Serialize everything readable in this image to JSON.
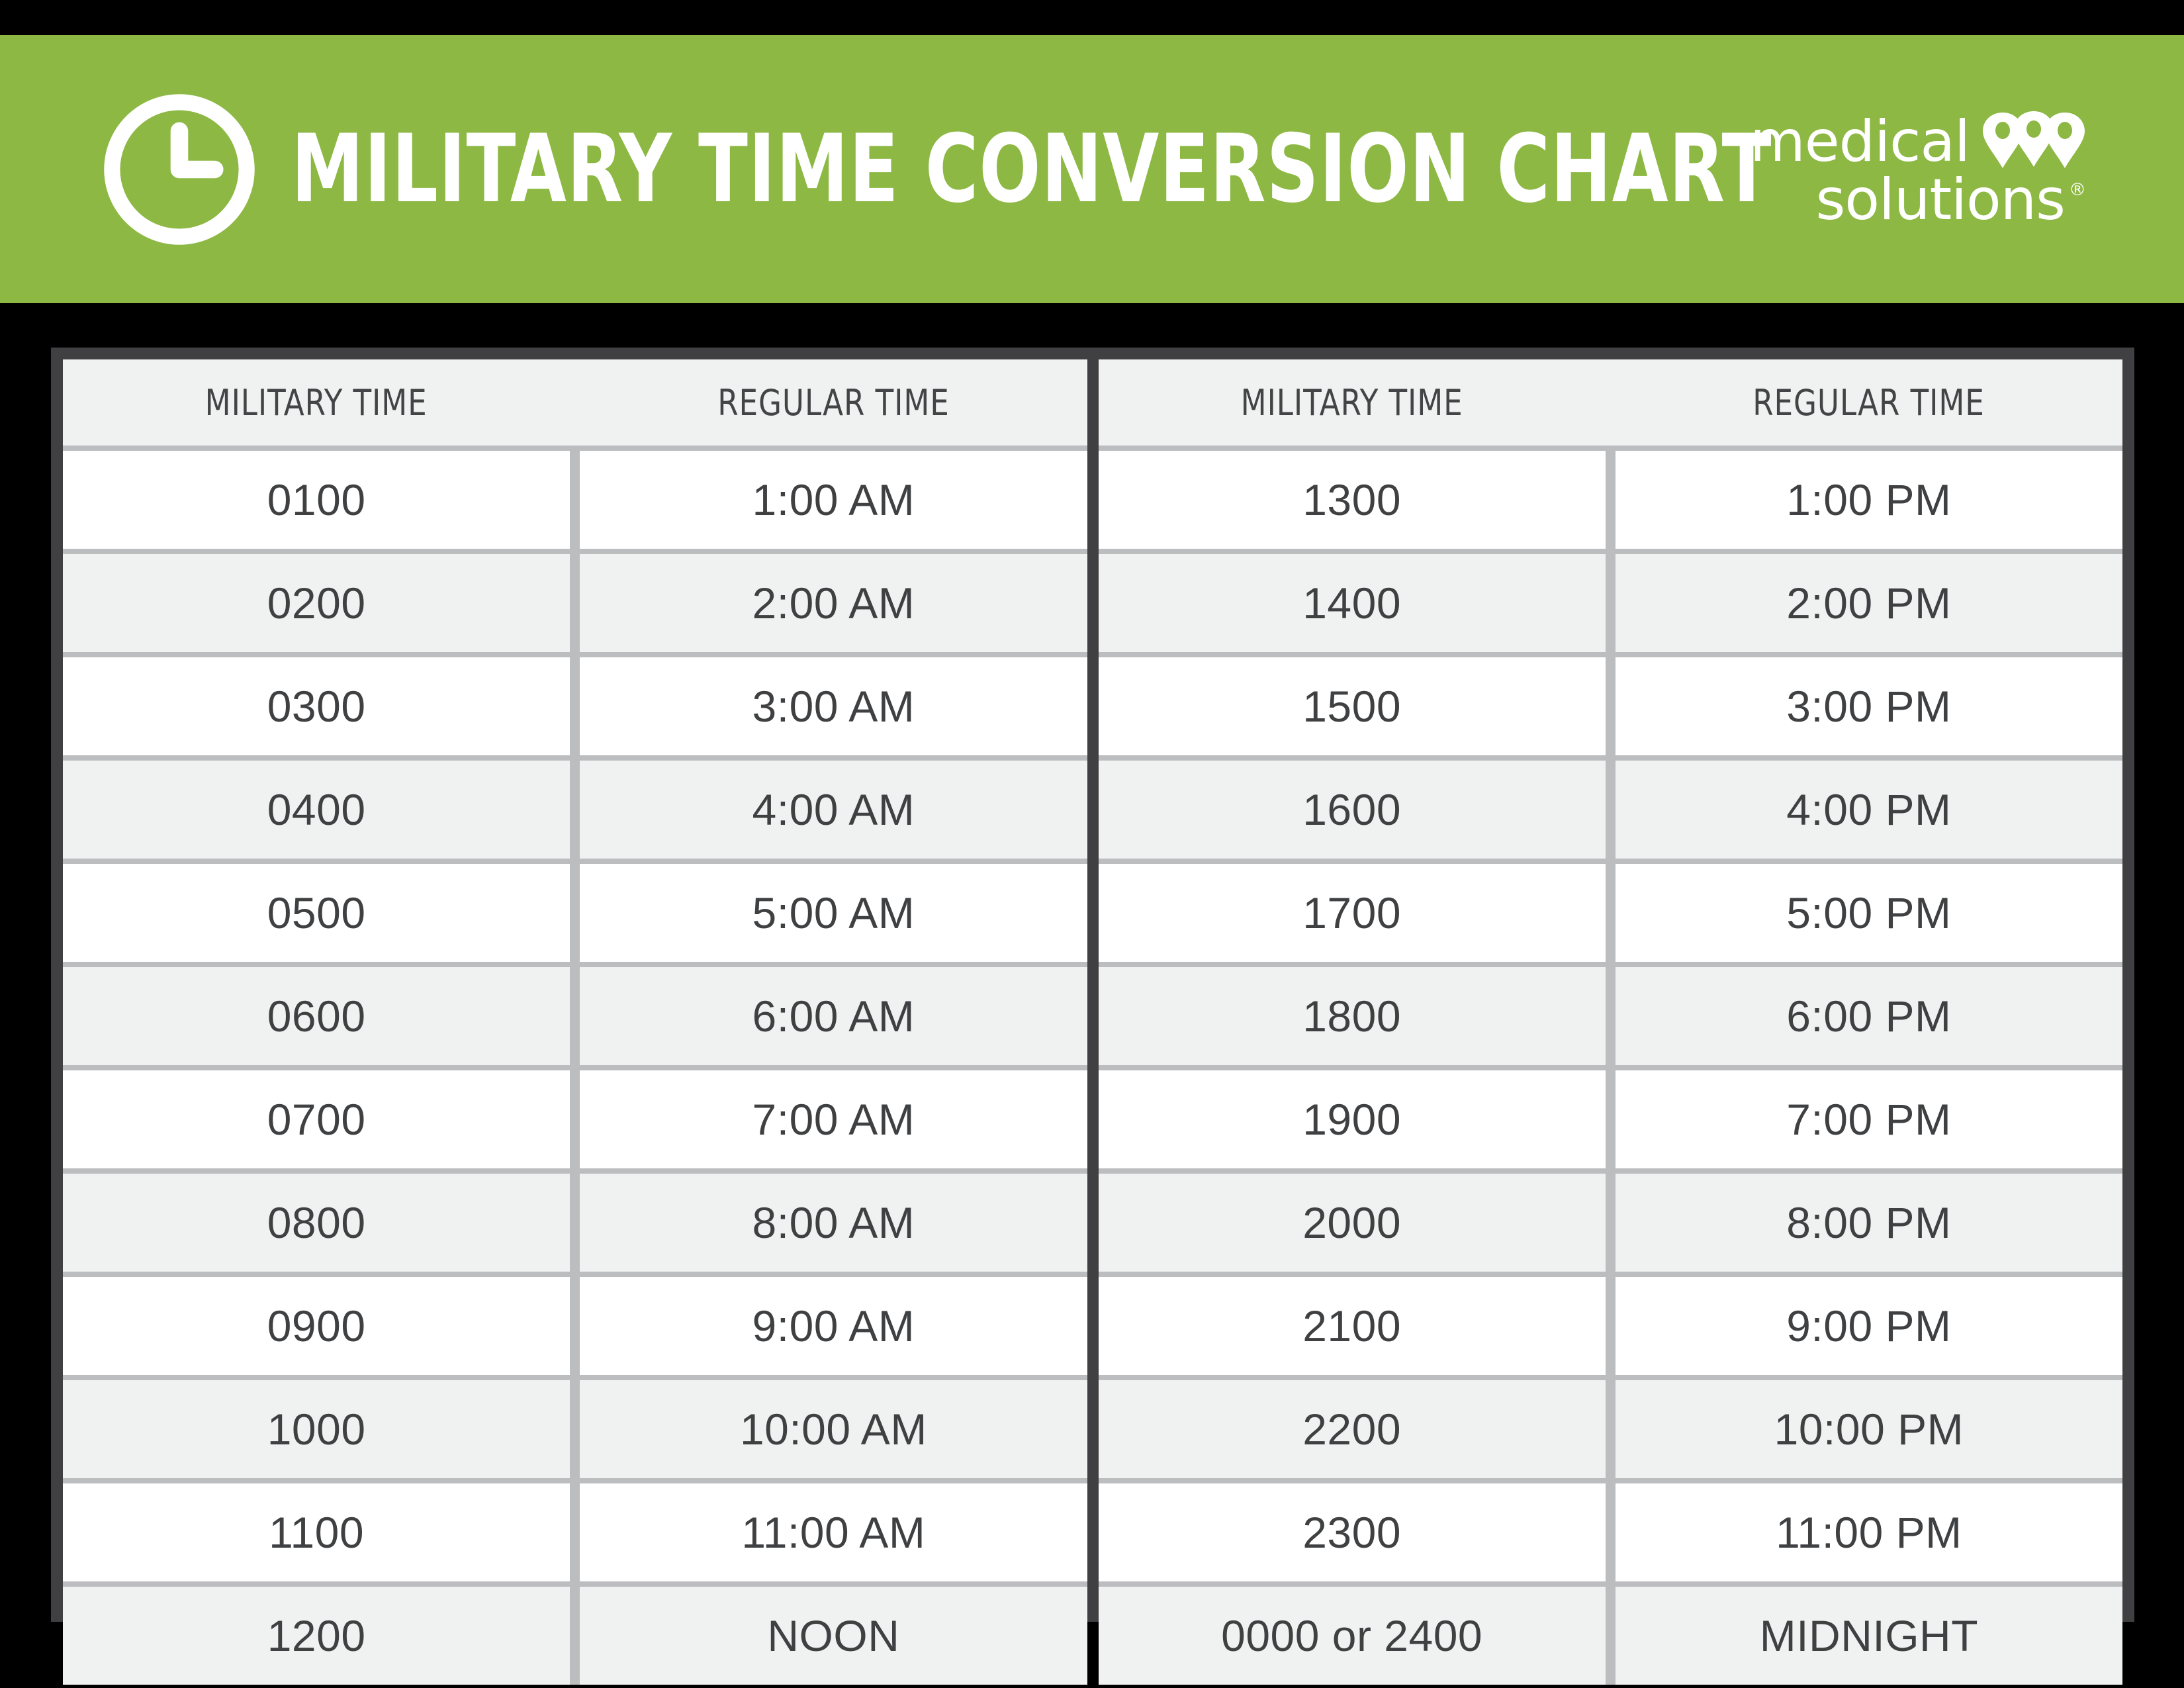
{
  "colors": {
    "banner_green": "#8cb843",
    "frame_dark": "#404042",
    "row_separator": "#bcbdbf",
    "row_alt": "#f0f1f1",
    "row_base": "#ffffff",
    "text_dark": "#3f4042",
    "page_background": "#000000"
  },
  "header": {
    "title": "MILITARY TIME CONVERSION CHART",
    "clock_icon": "clock-icon",
    "logo": {
      "line1": "medical",
      "line2": "solutions",
      "registered_mark": "®",
      "pins_icon": "three-map-pins-icon"
    }
  },
  "table": {
    "columns": {
      "military": "MILITARY TIME",
      "regular": "REGULAR TIME"
    },
    "left": {
      "headers": [
        "MILITARY TIME",
        "REGULAR TIME"
      ],
      "rows": [
        [
          "0100",
          "1:00 AM"
        ],
        [
          "0200",
          "2:00 AM"
        ],
        [
          "0300",
          "3:00 AM"
        ],
        [
          "0400",
          "4:00 AM"
        ],
        [
          "0500",
          "5:00 AM"
        ],
        [
          "0600",
          "6:00 AM"
        ],
        [
          "0700",
          "7:00 AM"
        ],
        [
          "0800",
          "8:00 AM"
        ],
        [
          "0900",
          "9:00 AM"
        ],
        [
          "1000",
          "10:00 AM"
        ],
        [
          "1100",
          "11:00 AM"
        ],
        [
          "1200",
          "NOON"
        ]
      ]
    },
    "right": {
      "headers": [
        "MILITARY TIME",
        "REGULAR TIME"
      ],
      "rows": [
        [
          "1300",
          "1:00 PM"
        ],
        [
          "1400",
          "2:00 PM"
        ],
        [
          "1500",
          "3:00 PM"
        ],
        [
          "1600",
          "4:00 PM"
        ],
        [
          "1700",
          "5:00 PM"
        ],
        [
          "1800",
          "6:00 PM"
        ],
        [
          "1900",
          "7:00 PM"
        ],
        [
          "2000",
          "8:00 PM"
        ],
        [
          "2100",
          "9:00 PM"
        ],
        [
          "2200",
          "10:00 PM"
        ],
        [
          "2300",
          "11:00 PM"
        ],
        [
          "0000 or 2400",
          "MIDNIGHT"
        ]
      ]
    }
  }
}
